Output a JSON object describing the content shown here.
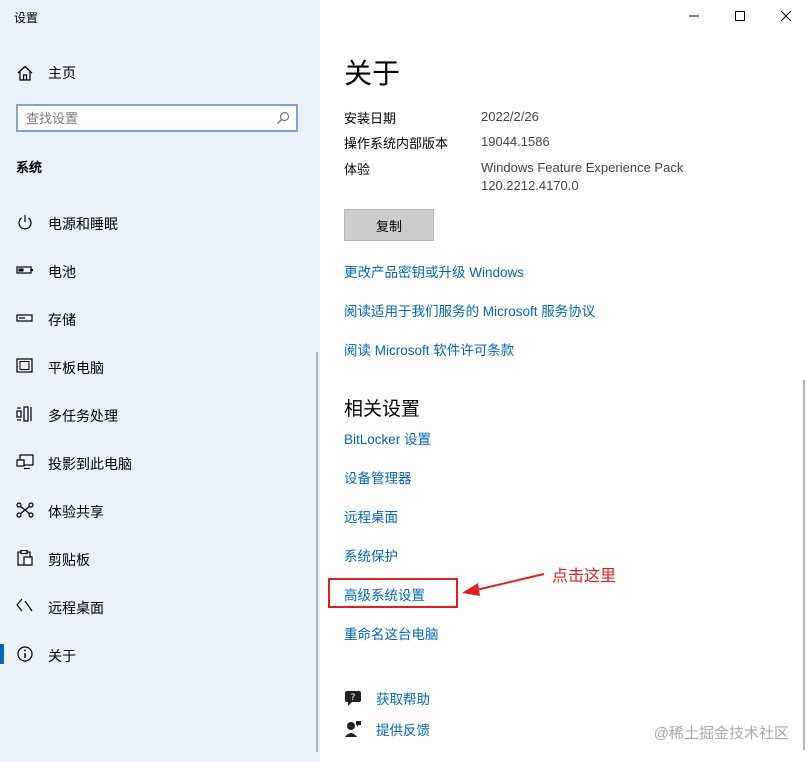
{
  "app": {
    "title": "设置"
  },
  "sidebar": {
    "home_label": "主页",
    "search_placeholder": "查找设置",
    "section_heading": "系统",
    "items": [
      {
        "label": "电源和睡眠",
        "icon": "power-icon"
      },
      {
        "label": "电池",
        "icon": "battery-icon"
      },
      {
        "label": "存储",
        "icon": "storage-icon"
      },
      {
        "label": "平板电脑",
        "icon": "tablet-icon"
      },
      {
        "label": "多任务处理",
        "icon": "multitasking-icon"
      },
      {
        "label": "投影到此电脑",
        "icon": "projecting-icon"
      },
      {
        "label": "体验共享",
        "icon": "shared-experiences-icon"
      },
      {
        "label": "剪贴板",
        "icon": "clipboard-icon"
      },
      {
        "label": "远程桌面",
        "icon": "remote-desktop-icon"
      },
      {
        "label": "关于",
        "icon": "about-icon",
        "selected": true
      }
    ]
  },
  "main": {
    "title": "关于",
    "specs": [
      {
        "key": "安装日期",
        "value": "2022/2/26"
      },
      {
        "key": "操作系统内部版本",
        "value": "19044.1586"
      },
      {
        "key": "体验",
        "value": "Windows Feature Experience Pack",
        "value2": "120.2212.4170.0"
      }
    ],
    "copy_label": "复制",
    "links": [
      "更改产品密钥或升级 Windows",
      "阅读适用于我们服务的 Microsoft 服务协议",
      "阅读 Microsoft 软件许可条款"
    ],
    "related_title": "相关设置",
    "related_links": [
      "BitLocker 设置",
      "设备管理器",
      "远程桌面",
      "系统保护",
      "高级系统设置",
      "重命名这台电脑"
    ],
    "help_label": "获取帮助",
    "feedback_label": "提供反馈"
  },
  "annotation": {
    "text": "点击这里",
    "color": "#e02020"
  },
  "watermark": "@稀土掘金技术社区",
  "colors": {
    "accent": "#0067c0",
    "sidebar_bg": "#eaf1f8"
  }
}
